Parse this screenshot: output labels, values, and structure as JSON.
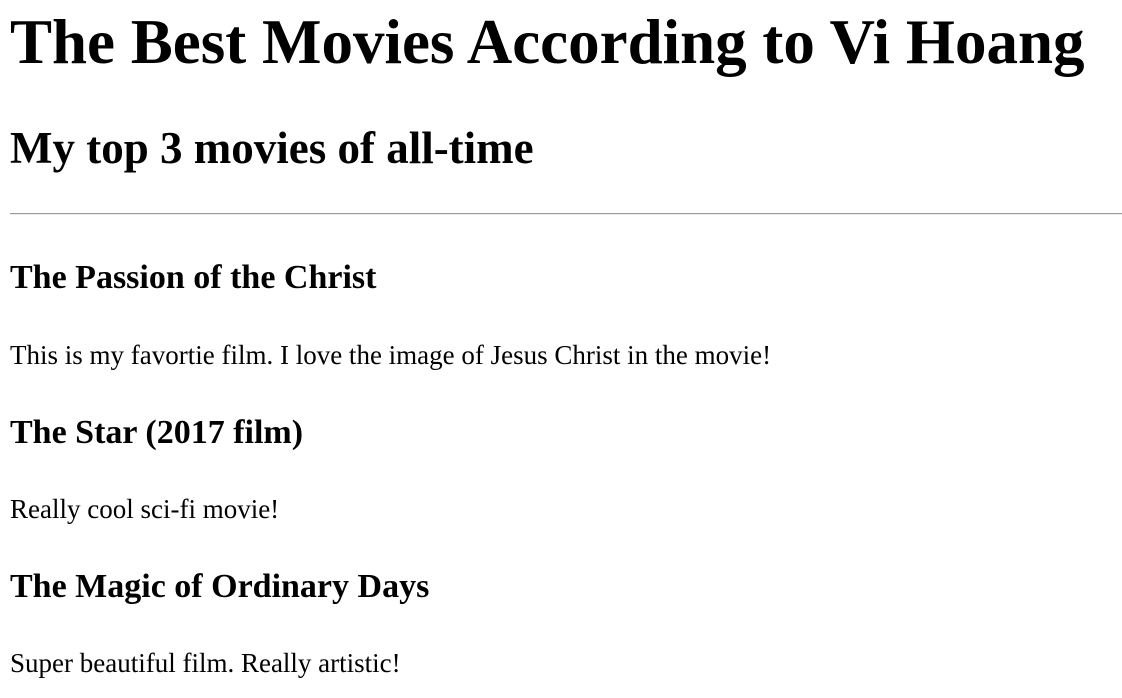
{
  "page": {
    "title": "The Best Movies According to Vi Hoang",
    "subtitle": "My top 3 movies of all-time"
  },
  "movies": [
    {
      "title": "The Passion of the Christ",
      "description": "This is my favortie film. I love the image of Jesus Christ in the movie!"
    },
    {
      "title": "The Star (2017 film)",
      "description": "Really cool sci-fi movie!"
    },
    {
      "title": "The Magic of Ordinary Days",
      "description": "Super beautiful film. Really artistic!"
    }
  ]
}
